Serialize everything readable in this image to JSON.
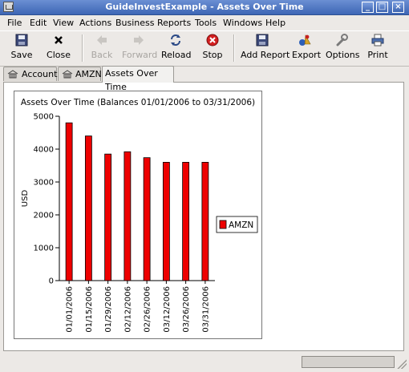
{
  "window": {
    "title": "GuideInvestExample - Assets Over Time"
  },
  "menu": [
    "File",
    "Edit",
    "View",
    "Actions",
    "Business",
    "Reports",
    "Tools",
    "Windows",
    "Help"
  ],
  "toolbar": {
    "save": "Save",
    "close": "Close",
    "back": "Back",
    "forward": "Forward",
    "reload": "Reload",
    "stop": "Stop",
    "add_report": "Add Report",
    "export": "Export",
    "options": "Options",
    "print": "Print"
  },
  "tabs": [
    "Accounts",
    "AMZN",
    "Assets Over Time"
  ],
  "chart_data": {
    "type": "bar",
    "title": "Assets Over Time (Balances 01/01/2006 to 03/31/2006)",
    "ylabel": "USD",
    "ylim": [
      0,
      5000
    ],
    "yticks": [
      0,
      1000,
      2000,
      3000,
      4000,
      5000
    ],
    "categories": [
      "01/01/2006",
      "01/15/2006",
      "01/29/2006",
      "02/12/2006",
      "02/26/2006",
      "03/12/2006",
      "03/26/2006",
      "03/31/2006"
    ],
    "series": [
      {
        "name": "AMZN",
        "color": "#ee0000",
        "values": [
          4800,
          4400,
          3850,
          3920,
          3740,
          3600,
          3600,
          3600
        ]
      }
    ],
    "legend": "right",
    "grid": false
  }
}
